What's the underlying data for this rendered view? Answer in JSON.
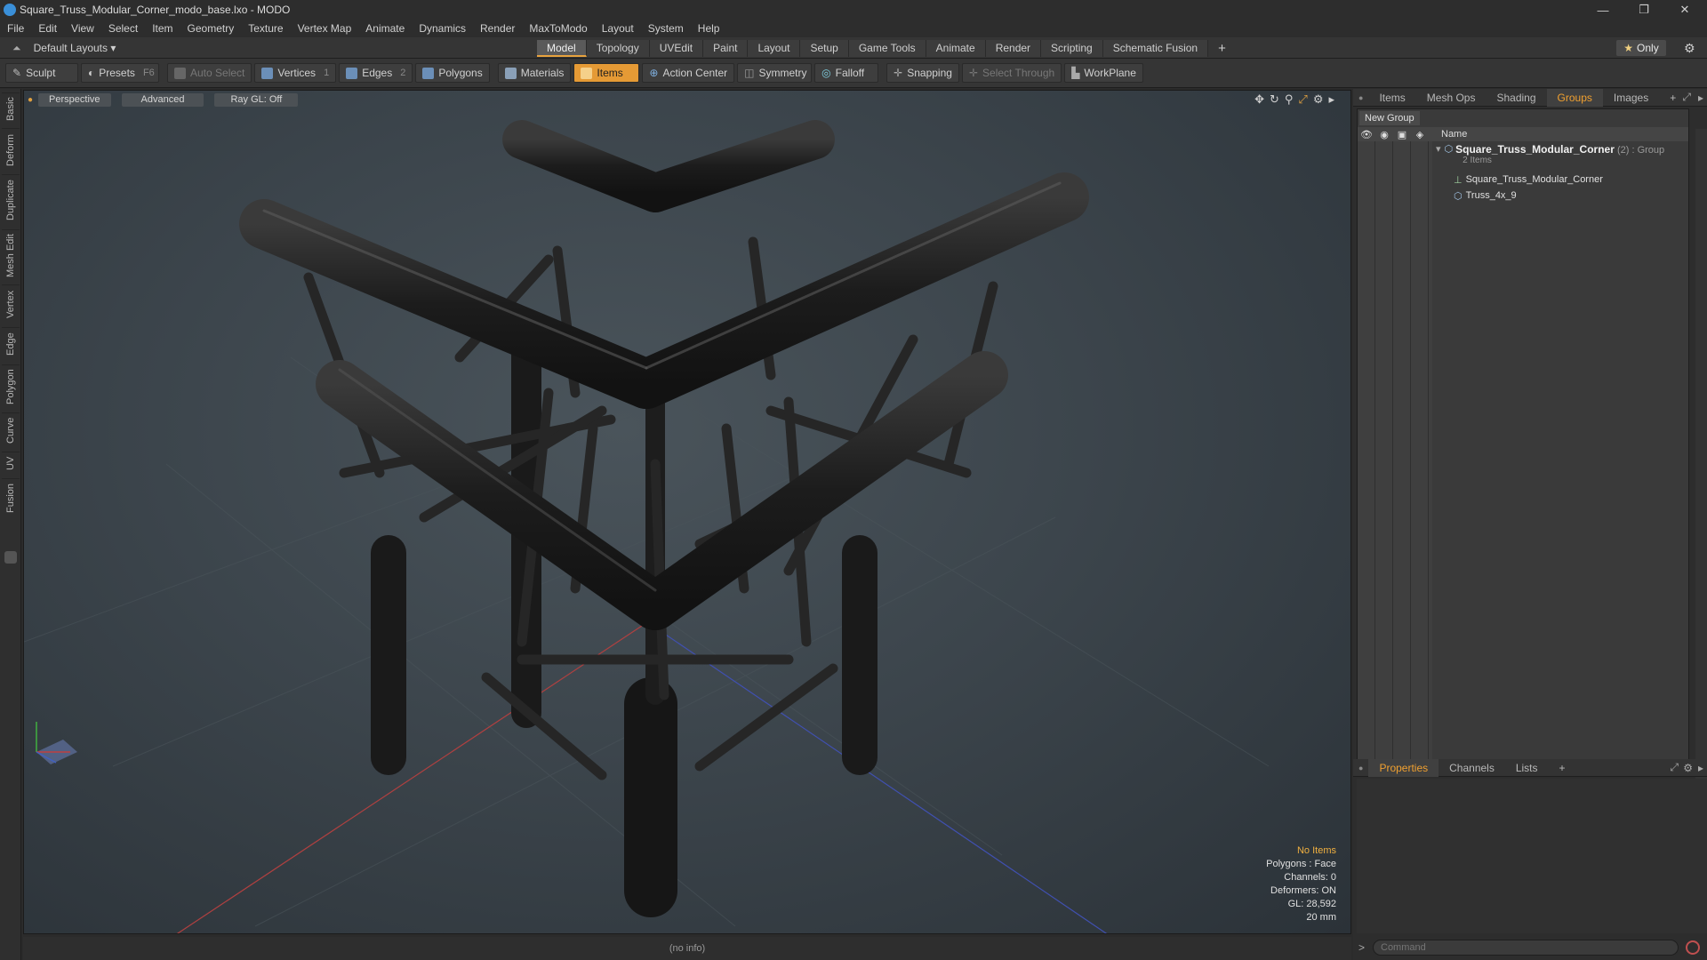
{
  "window": {
    "title": "Square_Truss_Modular_Corner_modo_base.lxo - MODO",
    "minimize": "—",
    "maximize": "❐",
    "close": "✕"
  },
  "menu": [
    "File",
    "Edit",
    "View",
    "Select",
    "Item",
    "Geometry",
    "Texture",
    "Vertex Map",
    "Animate",
    "Dynamics",
    "Render",
    "MaxToModo",
    "Layout",
    "System",
    "Help"
  ],
  "layouts": {
    "label": "Default Layouts ▾",
    "tabs": [
      "Model",
      "Topology",
      "UVEdit",
      "Paint",
      "Layout",
      "Setup",
      "Game Tools",
      "Animate",
      "Render",
      "Scripting",
      "Schematic Fusion"
    ],
    "active_tab": "Model",
    "add": "+",
    "only": "Only"
  },
  "toolbar": {
    "sculpt": "Sculpt",
    "presets": "Presets",
    "presets_key": "F6",
    "auto_select": "Auto Select",
    "vertices": "Vertices",
    "vertices_key": "1",
    "edges": "Edges",
    "edges_key": "2",
    "polygons": "Polygons",
    "materials": "Materials",
    "items": "Items",
    "action_center": "Action Center",
    "symmetry": "Symmetry",
    "falloff": "Falloff",
    "snapping": "Snapping",
    "select_through": "Select Through",
    "workplane": "WorkPlane"
  },
  "side_tabs": [
    "Basic",
    "Deform",
    "Duplicate",
    "Mesh Edit",
    "Vertex",
    "Edge",
    "Polygon",
    "Curve",
    "UV",
    "Fusion"
  ],
  "viewport": {
    "view": "Perspective",
    "shading": "Advanced",
    "raygl": "Ray GL: Off",
    "info": {
      "selection": "No Items",
      "polygons": "Polygons : Face",
      "channels": "Channels: 0",
      "deformers": "Deformers: ON",
      "gl": "GL: 28,592",
      "unit": "20 mm"
    }
  },
  "status": "(no info)",
  "panel_top": {
    "tabs": [
      "Items",
      "Mesh Ops",
      "Shading",
      "Groups",
      "Images"
    ],
    "active": "Groups",
    "add": "+"
  },
  "groups": {
    "new_group": "New Group",
    "col_name": "Name",
    "root": {
      "name": "Square_Truss_Modular_Corner",
      "count": "(2)",
      "type": ": Group",
      "sub": "2 Items"
    },
    "children": [
      "Square_Truss_Modular_Corner",
      "Truss_4x_9"
    ]
  },
  "panel_bottom": {
    "tabs": [
      "Properties",
      "Channels",
      "Lists"
    ],
    "active": "Properties",
    "add": "+"
  },
  "command": {
    "placeholder": "Command",
    "prompt": ">"
  }
}
